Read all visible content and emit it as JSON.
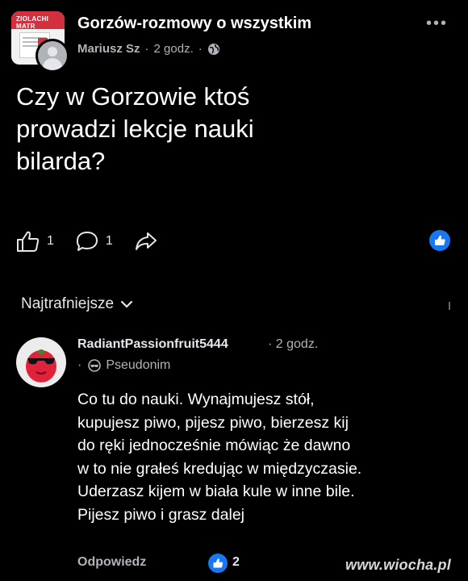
{
  "post": {
    "group_name": "Gorzów-rozmowy o wszystkim",
    "thumbnail_text": "ZIOLACHI MATR",
    "author": "Mariusz Sz",
    "separator": "·",
    "time": "2 godz.",
    "visibility_icon": "globe-icon",
    "text": "Czy w Gorzowie ktoś\nprowadzi lekcje nauki\nbilarda?",
    "like_count": "1",
    "comment_count": "1"
  },
  "comments": {
    "sort_label": "Najtrafniejsze",
    "items": [
      {
        "author": "RadiantPassionfruit5444",
        "time": "2 godz.",
        "pseudonym_label": "Pseudonim",
        "text": "Co tu do nauki. Wynajmujesz stół,\nkupujesz piwo, pijesz piwo, bierzesz kij\ndo ręki jednocześnie mówiąc że dawno\nw to nie grałeś kredując w międzyczasie.\nUderzasz kijem w biała kule w inne bile.\nPijesz piwo i grasz dalej",
        "reply_label": "Odpowiedz",
        "like_count": "2"
      }
    ]
  },
  "watermark": "www.wiocha.pl",
  "colors": {
    "background": "#000000",
    "accent": "#1877f2",
    "muted": "#b0b3b8"
  }
}
